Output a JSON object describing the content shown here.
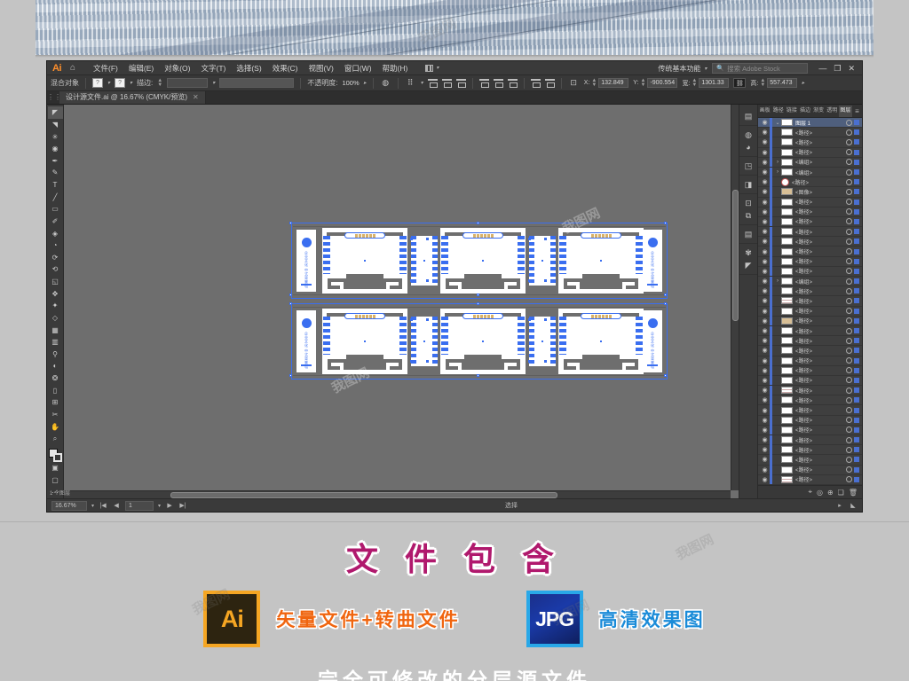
{
  "app": {
    "logo": "Ai",
    "home_icon": "home-icon",
    "menus": [
      {
        "label": "文件(F)"
      },
      {
        "label": "编辑(E)"
      },
      {
        "label": "对象(O)"
      },
      {
        "label": "文字(T)"
      },
      {
        "label": "选择(S)"
      },
      {
        "label": "效果(C)"
      },
      {
        "label": "视图(V)"
      },
      {
        "label": "窗口(W)"
      },
      {
        "label": "帮助(H)"
      }
    ],
    "arrange_documents": "arrange-documents-icon",
    "workspace": "传统基本功能",
    "stock_search_placeholder": "搜索 Adobe Stock",
    "window_minimize": "—",
    "window_restore": "❐",
    "window_close": "✕"
  },
  "control_bar": {
    "object_type": "混合对象",
    "fill_swatch": "fill-swatch",
    "stroke_swatch": "stroke-swatch",
    "stroke_label": "描边:",
    "stroke_weight": "",
    "opacity_label": "不透明度:",
    "opacity_value": "100%",
    "style_label": "",
    "align_label": "对齐",
    "transform": {
      "x_label": "X:",
      "x_value": "132.849",
      "y_label": "Y:",
      "y_value": "-900.554",
      "w_label": "宽:",
      "w_value": "1301.33",
      "h_label": "高:",
      "h_value": "557.473",
      "lock_icon": "link-proportions-icon"
    }
  },
  "document_tab": {
    "title": "设计源文件.ai @ 16.67% (CMYK/预览)",
    "close": "✕"
  },
  "toolbar": {
    "tools": [
      {
        "name": "selection-tool",
        "glyph": "◣"
      },
      {
        "name": "direct-selection-tool",
        "glyph": "◤"
      },
      {
        "name": "magic-wand-tool",
        "glyph": "✳"
      },
      {
        "name": "lasso-tool",
        "glyph": "◉"
      },
      {
        "name": "pen-tool",
        "glyph": "✒"
      },
      {
        "name": "curvature-tool",
        "glyph": "✎"
      },
      {
        "name": "type-tool",
        "glyph": "T"
      },
      {
        "name": "line-segment-tool",
        "glyph": "╱"
      },
      {
        "name": "rectangle-tool",
        "glyph": "▭"
      },
      {
        "name": "paintbrush-tool",
        "glyph": "🖌"
      },
      {
        "name": "shaper-tool",
        "glyph": "✑"
      },
      {
        "name": "eraser-tool",
        "glyph": "◔"
      },
      {
        "name": "rotate-tool",
        "glyph": "◈"
      },
      {
        "name": "scale-tool",
        "glyph": "⟲"
      },
      {
        "name": "width-tool",
        "glyph": "◱"
      },
      {
        "name": "free-transform-tool",
        "glyph": "✥"
      },
      {
        "name": "shape-builder-tool",
        "glyph": "✦"
      },
      {
        "name": "perspective-grid-tool",
        "glyph": "◇"
      },
      {
        "name": "mesh-tool",
        "glyph": "▦"
      },
      {
        "name": "gradient-tool",
        "glyph": "▥"
      },
      {
        "name": "eyedropper-tool",
        "glyph": "⚲"
      },
      {
        "name": "blend-tool",
        "glyph": "◐"
      },
      {
        "name": "symbol-sprayer-tool",
        "glyph": "❂"
      },
      {
        "name": "column-graph-tool",
        "glyph": "▯"
      },
      {
        "name": "artboard-tool",
        "glyph": "⊞"
      },
      {
        "name": "slice-tool",
        "glyph": "✂"
      },
      {
        "name": "hand-tool",
        "glyph": "✋"
      },
      {
        "name": "zoom-tool",
        "glyph": "🔍"
      }
    ],
    "fill_stroke": "fill-stroke-indicator",
    "screen_mode": "screen-mode-icon",
    "more_tools": "⋯"
  },
  "canvas": {
    "background": "#6e6e6e",
    "artwork_rows": [
      {
        "name": "artwork-row-top",
        "plaque_text": "中式装饰文化墙",
        "endcap_text": "企业文化 中式背景墙"
      },
      {
        "name": "artwork-row-bottom",
        "plaque_text": "中式装饰文化墙",
        "endcap_text": "企业文化 中式背景墙"
      }
    ]
  },
  "dock_rail": {
    "icons": [
      {
        "name": "properties-icon",
        "glyph": "▤"
      },
      {
        "name": "color-icon",
        "glyph": "◍"
      },
      {
        "name": "color-guide-icon",
        "glyph": "◕"
      },
      {
        "name": "appearance-icon",
        "glyph": "◳"
      },
      {
        "name": "gradient-icon",
        "glyph": "◨"
      },
      {
        "name": "transform-icon",
        "glyph": "⊡"
      },
      {
        "name": "pathfinder-icon",
        "glyph": "⧉"
      },
      {
        "name": "align-icon",
        "glyph": "▤"
      },
      {
        "name": "brushes-icon",
        "glyph": "✾"
      },
      {
        "name": "symbols-icon",
        "glyph": "◤"
      }
    ]
  },
  "layers_panel": {
    "tabs": [
      {
        "label": "画板",
        "active": false
      },
      {
        "label": "路径",
        "active": false
      },
      {
        "label": "链接",
        "active": false
      },
      {
        "label": "描边",
        "active": false
      },
      {
        "label": "渐变",
        "active": false
      },
      {
        "label": "透明",
        "active": false
      },
      {
        "label": "图层",
        "active": true
      }
    ],
    "menu_icon": "panel-menu-icon",
    "root_layer": "图层 1",
    "sublayers": [
      {
        "name": "<路径>",
        "thumb": "white"
      },
      {
        "name": "<路径>",
        "thumb": "white"
      },
      {
        "name": "<路径>",
        "thumb": "white"
      },
      {
        "name": "<编组>",
        "thumb": "white",
        "expandable": true
      },
      {
        "name": "<编组>",
        "thumb": "white",
        "expandable": true
      },
      {
        "name": "<路径>",
        "thumb": "circle"
      },
      {
        "name": "<图像>",
        "thumb": "tan"
      },
      {
        "name": "<路径>",
        "thumb": "white"
      },
      {
        "name": "<路径>",
        "thumb": "white"
      },
      {
        "name": "<路径>",
        "thumb": "white"
      },
      {
        "name": "<路径>",
        "thumb": "white"
      },
      {
        "name": "<路径>",
        "thumb": "white"
      },
      {
        "name": "<路径>",
        "thumb": "white"
      },
      {
        "name": "<路径>",
        "thumb": "white"
      },
      {
        "name": "<路径>",
        "thumb": "white"
      },
      {
        "name": "<编组>",
        "thumb": "white",
        "expandable": true
      },
      {
        "name": "<路径>",
        "thumb": "white"
      },
      {
        "name": "<路径>",
        "thumb": "lines"
      },
      {
        "name": "<路径>",
        "thumb": "white"
      },
      {
        "name": "<路径>",
        "thumb": "tan"
      },
      {
        "name": "<路径>",
        "thumb": "white"
      },
      {
        "name": "<路径>",
        "thumb": "white"
      },
      {
        "name": "<路径>",
        "thumb": "white"
      },
      {
        "name": "<路径>",
        "thumb": "white"
      },
      {
        "name": "<路径>",
        "thumb": "white"
      },
      {
        "name": "<路径>",
        "thumb": "white"
      },
      {
        "name": "<路径>",
        "thumb": "lines"
      },
      {
        "name": "<路径>",
        "thumb": "white"
      },
      {
        "name": "<路径>",
        "thumb": "white"
      },
      {
        "name": "<路径>",
        "thumb": "white"
      },
      {
        "name": "<路径>",
        "thumb": "white"
      },
      {
        "name": "<路径>",
        "thumb": "white"
      },
      {
        "name": "<路径>",
        "thumb": "white"
      },
      {
        "name": "<路径>",
        "thumb": "white"
      },
      {
        "name": "<路径>",
        "thumb": "white"
      },
      {
        "name": "<路径>",
        "thumb": "lines"
      }
    ],
    "footer_count": "1 个图层",
    "footer_icons": [
      {
        "name": "locate-object-icon",
        "glyph": "⌖"
      },
      {
        "name": "make-clipping-mask-icon",
        "glyph": "◎"
      },
      {
        "name": "create-sublayer-icon",
        "glyph": "⊕"
      },
      {
        "name": "create-layer-icon",
        "glyph": "❏"
      },
      {
        "name": "delete-layer-icon",
        "glyph": "🗑"
      }
    ]
  },
  "status_bar": {
    "zoom_value": "16.67%",
    "first_page": "|◀",
    "prev_page": "◀",
    "page_value": "1",
    "next_page": "▶",
    "last_page": "▶|",
    "status_text": "选择",
    "resize_grip": "◣"
  },
  "promo": {
    "title": "文 件 包 含",
    "items": [
      {
        "badge": "Ai",
        "badge_kind": "ai",
        "label": "矢量文件+转曲文件"
      },
      {
        "badge": "JPG",
        "badge_kind": "jpg",
        "label": "高清效果图"
      }
    ],
    "bottom_text": "完全可修改的分层源文件"
  },
  "watermarks": {
    "text": "我图网"
  },
  "colors": {
    "ai_orange": "#ff8f2b",
    "selection_blue": "#3a6ef0",
    "promo_magenta": "#b0196d",
    "promo_orange": "#f0650f",
    "promo_blue": "#1a8bd8",
    "ui_dark": "#3a3a3a",
    "canvas_gray": "#6e6e6e"
  }
}
